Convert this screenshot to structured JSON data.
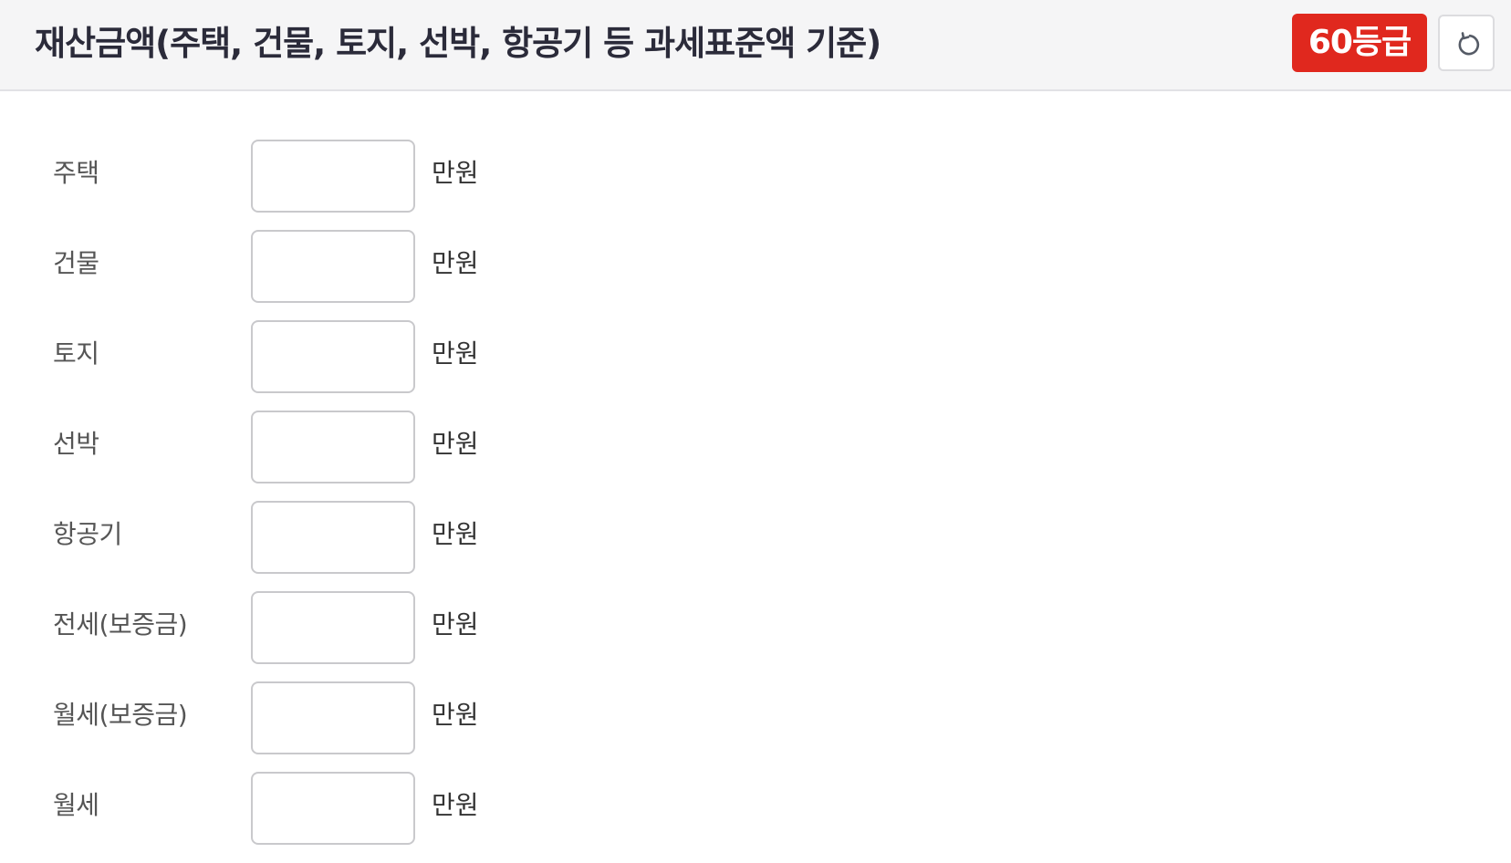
{
  "header": {
    "title": "재산금액(주택, 건물, 토지, 선박, 항공기 등 과세표준액 기준)",
    "grade_badge": "60등급",
    "reset_icon": "refresh-icon"
  },
  "colors": {
    "badge_bg": "#e0281e",
    "header_bg": "#f5f5f6"
  },
  "form": {
    "rows": [
      {
        "label": "주택",
        "value": "",
        "unit": "만원"
      },
      {
        "label": "건물",
        "value": "",
        "unit": "만원"
      },
      {
        "label": "토지",
        "value": "",
        "unit": "만원"
      },
      {
        "label": "선박",
        "value": "",
        "unit": "만원"
      },
      {
        "label": "항공기",
        "value": "",
        "unit": "만원"
      },
      {
        "label": "전세(보증금)",
        "value": "",
        "unit": "만원"
      },
      {
        "label": "월세(보증금)",
        "value": "",
        "unit": "만원"
      },
      {
        "label": "월세",
        "value": "",
        "unit": "만원"
      }
    ]
  }
}
